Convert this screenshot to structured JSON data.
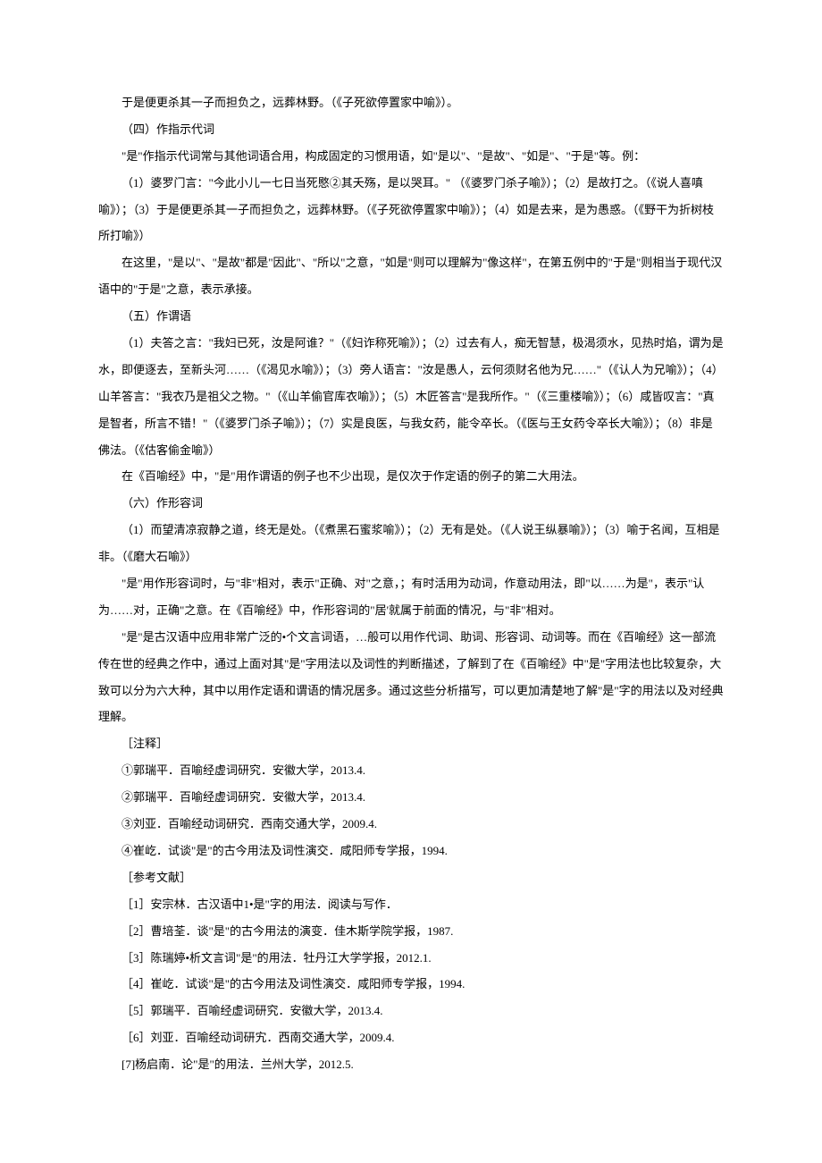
{
  "paragraphs": [
    "于是便更杀其一子而担负之，远葬林野。（《子死欲停置家中喻》）。",
    "（四）作指示代词",
    "\"是\"作指示代词常与其他词语合用，构成固定的习惯用语，如\"是以\"、\"是故\"、\"如是\"、\"于是\"等。例：",
    "（1）婆罗门言：\"今此小儿一七日当死愍②其夭殇，是以哭耳。\" （《婆罗门杀子喻》）；（2）是故打之。（《说人喜嗔喻》）；（3）于是便更杀其一子而担负之，远葬林野。（《子死欲停置家中喻》）；（4）如是去来，是为愚惑。（《野干为折树枝所打喻》）",
    "在这里，\"是以\"、\"是故\"都是\"因此\"、\"所以\"之意，\"如是\"则可以理解为\"像这样\"，在第五例中的\"于是\"则相当于现代汉语中的\"于是\"之意，表示承接。",
    "（五）作谓语",
    "（1）夫答之言：\"我妇已死，汝是阿谁？\"（《妇诈称死喻》）；（2）过去有人，痴无智慧，极渴须水，见热时焰，谓为是水，即便逐去，至新头河……（《渴见水喻》）；（3）旁人语言：\"汝是愚人，云何须财名他为兄……\"（《认人为兄喻》）；（4）山羊答言：\"我衣乃是祖父之物。\"（《山羊偷官库衣喻》）；（5）木匠答言\"是我所作。\"（《三重楼喻》）；（6）咸皆叹言：\"真是智者，所言不错！\"（《婆罗门杀子喻》）；（7）实是良医，与我女药，能令卒长。（《医与王女药令卒长大喻》）；（8）非是佛法。（《估客偷金喻》）",
    "在《百喻经》中，\"是\"用作谓语的例子也不少出现，是仅次于作定语的例子的第二大用法。",
    "（六）作形容词",
    "（1）而望清凉寂静之道，终无是处。（《煮黑石蜜浆喻》）；（2）无有是处。（《人说王纵暴喻》）；（3）喻于名闻，互相是非。（《磨大石喻》）",
    "\"是\"用作形容词时，与\"非\"相对，表示\"正确、对\"之意，；有时活用为动词，作意动用法，即\"以……为是\"，表示\"认为……对，正确\"之意。在《百喻经》中，作形容词的\"居'就属于前面的情况，与\"非\"相对。",
    "\"是\"是古汉语中应用非常广泛的•个文言词语，…般可以用作代词、助词、形容词、动词等。而在《百喻经》这一部流传在世的经典之作中，通过上面对其\"是\"字用法以及词性的判断描述，了解到了在《百喻经》中\"是\"字用法也比较复杂，大致可以分为六大种，其中以用作定语和谓语的情况居多。通过这些分析描写，可以更加清楚地了解\"是\"字的用法以及对经典理解。",
    "［注释］",
    "①郭瑞平．百喻经虚词研究．安徽大学，2013.4.",
    "②郭瑞平．百喻经虚词研究．安徽大学，2013.4.",
    "③刘亚．百喻经动词研究．西南交通大学，2009.4.",
    "④崔屹．试谈\"是\"的古今用法及词性演交．咸阳师专学报，1994.",
    "［参考文献］",
    "［1］安宗林．古汉语中1•是\"字的用法．阅读与写作．",
    "［2］曹培荃．谈\"是\"的古今用法的演变．佳木斯学院学报，1987.",
    "［3］陈瑞婷•析文言词\"是\"的用法．牡丹江大学学报，2012.1.",
    "［4］崔屹．试谈\"是\"的古今用法及词性演交．咸阳师专学报，1994.",
    "［5］郭瑞平．百喻经虚词研究．安徽大学，2013.4.",
    "［6］刘亚．百喻经动词研宄．西南交通大学，2009.4.",
    "[7]杨启南．论\"是\"的用法．兰州大学，2012.5."
  ]
}
